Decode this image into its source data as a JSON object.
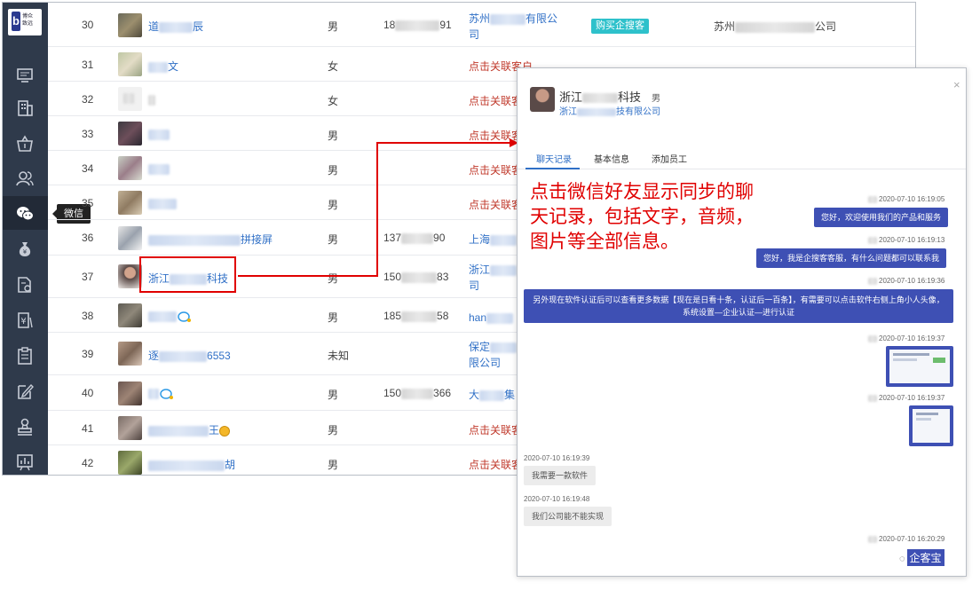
{
  "sidebar": {
    "logo_text": "博众\n致远",
    "tooltip": "微信",
    "nav_icons": [
      "monitor-icon",
      "building-icon",
      "basket-icon",
      "users-icon",
      "wechat-icon",
      "money-bag-icon",
      "document-gear-icon",
      "yuan-document-icon",
      "clipboard-icon",
      "edit-icon",
      "stamp-icon",
      "chart-board-icon"
    ]
  },
  "table": {
    "rows": [
      {
        "num": "30",
        "nick_pre": "道",
        "nick_post": "辰",
        "gender": "男",
        "phone_pre": "18",
        "phone_post": "91",
        "company_pre": "苏州",
        "company_post": "有限公",
        "company_line2": "司",
        "badge": "购买企搜客",
        "company2_pre": "苏州",
        "company2_post": "公司"
      },
      {
        "num": "31",
        "nick_pre": "",
        "nick_post": "文",
        "gender": "女",
        "link": "点击关联客户"
      },
      {
        "num": "32",
        "nick_pre": "",
        "nick_post": "",
        "gender": "女",
        "link": "点击关联客户"
      },
      {
        "num": "33",
        "nick_pre": "",
        "nick_post": "",
        "gender": "男",
        "link": "点击关联客"
      },
      {
        "num": "34",
        "nick_pre": "",
        "nick_post": "",
        "gender": "男",
        "link": "点击关联客"
      },
      {
        "num": "35",
        "nick_pre": "",
        "nick_post": "",
        "gender": "男",
        "link": "点击关联客"
      },
      {
        "num": "36",
        "nick_pre": "",
        "nick_post": "拼接屏",
        "gender": "男",
        "phone_pre": "137",
        "phone_post": "90",
        "company_pre": "上海",
        "company_post": ""
      },
      {
        "num": "37",
        "nick_pre": "浙江",
        "nick_post": "科技",
        "gender": "男",
        "phone_pre": "150",
        "phone_post": "83",
        "company_pre": "浙江",
        "company_post": "",
        "company_line2": "司"
      },
      {
        "num": "38",
        "nick_pre": "",
        "nick_post": "",
        "gender": "男",
        "phone_pre": "185",
        "phone_post": "58",
        "company_pre": "han",
        "company_post": ""
      },
      {
        "num": "39",
        "nick_pre": "逐",
        "nick_post": "6553",
        "gender": "未知",
        "company_pre": "保定",
        "company_post": "",
        "company_line2": "限公司"
      },
      {
        "num": "40",
        "nick_pre": "",
        "nick_post": "",
        "gender": "男",
        "phone_pre": "150",
        "phone_post": "366",
        "company_pre": "大",
        "company_post": "集"
      },
      {
        "num": "41",
        "nick_pre": "",
        "nick_post": "王",
        "gender": "男",
        "link": "点击关联客"
      },
      {
        "num": "42",
        "nick_pre": "",
        "nick_post": "胡",
        "gender": "男",
        "link": "点击关联客"
      }
    ]
  },
  "panel": {
    "name_pre": "浙江",
    "name_post": "科技",
    "gender": "男",
    "company_pre": "浙江",
    "company_post": "技有限公司",
    "close": "×",
    "tabs": [
      "聊天记录",
      "基本信息",
      "添加员工"
    ],
    "annotation": "点击微信好友显示同步的聊天记录，包括文字，音频，图片等全部信息。",
    "messages": [
      {
        "time": "2020-07-10 16:19:05",
        "text": "您好，欢迎使用我们的产品和服务"
      },
      {
        "time": "2020-07-10 16:19:13",
        "text": "您好，我是企搜客客服，有什么问题都可以联系我"
      },
      {
        "time": "2020-07-10 16:19:36",
        "text": "另外现在软件认证后可以查看更多数据【现在是日看十条，认证后一百条】，有需要可以点击软件右侧上角小人头像，系统设置—企业认证—进行认证"
      },
      {
        "time": "2020-07-10 16:19:37"
      },
      {
        "time": "2020-07-10 16:19:37"
      },
      {
        "time": "2020-07-10 16:19:39",
        "text": "我需要一款软件"
      },
      {
        "time": "2020-07-10 16:19:48",
        "text": "我们公司能不能实现"
      },
      {
        "time": "2020-07-10 16:20:29"
      }
    ],
    "watermark": "企客宝"
  }
}
